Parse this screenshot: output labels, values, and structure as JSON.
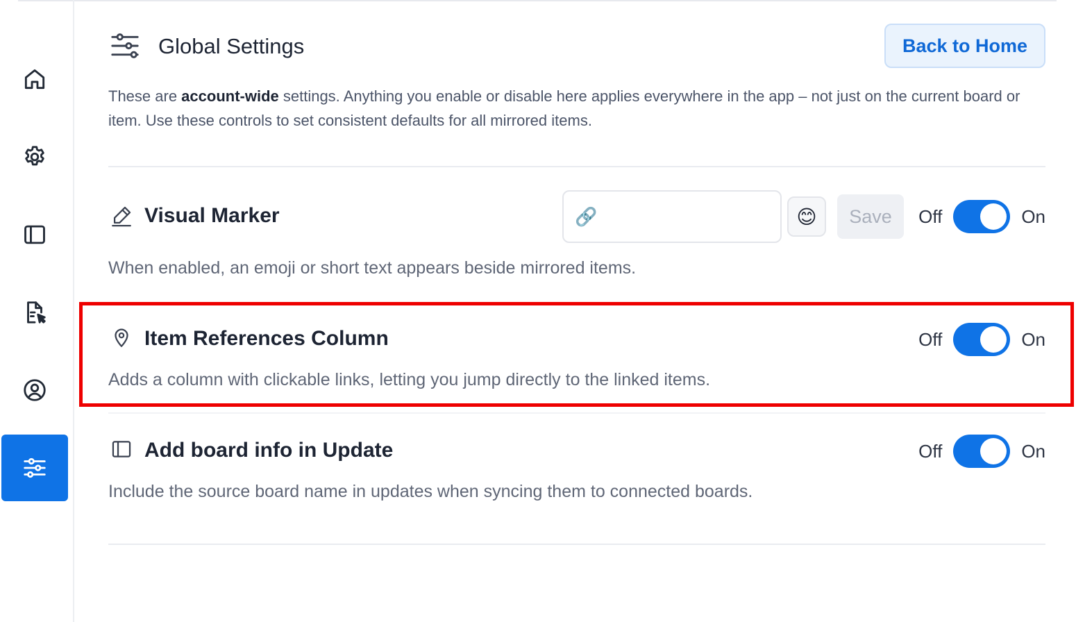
{
  "sidebar": {
    "items": [
      {
        "icon": "home-icon",
        "active": false
      },
      {
        "icon": "gear-icon",
        "active": false
      },
      {
        "icon": "panel-icon",
        "active": false
      },
      {
        "icon": "file-edit-icon",
        "active": false
      },
      {
        "icon": "user-circle-icon",
        "active": false
      },
      {
        "icon": "sliders-icon",
        "active": true
      }
    ]
  },
  "header": {
    "title": "Global Settings",
    "back_button": "Back to Home"
  },
  "intro": {
    "prefix": "These are ",
    "bold": "account-wide",
    "suffix": " settings. Anything you enable or disable here applies everywhere in the app – not just on the current board or item. Use these controls to set consistent defaults for all mirrored items."
  },
  "settings": {
    "visual_marker": {
      "title": "Visual Marker",
      "description": "When enabled, an emoji or short text appears beside mirrored items.",
      "marker_value": "🔗",
      "emoji_button": "😊",
      "save_label": "Save",
      "off_label": "Off",
      "on_label": "On",
      "enabled": true
    },
    "item_references": {
      "title": "Item References Column",
      "description": "Adds a column with clickable links, letting you jump directly to the linked items.",
      "off_label": "Off",
      "on_label": "On",
      "enabled": true
    },
    "board_info": {
      "title": "Add board info in Update",
      "description": "Include the source board name in updates when syncing them to connected boards.",
      "off_label": "Off",
      "on_label": "On",
      "enabled": true
    }
  },
  "colors": {
    "accent": "#0f73e6",
    "highlight": "#ee0000"
  }
}
